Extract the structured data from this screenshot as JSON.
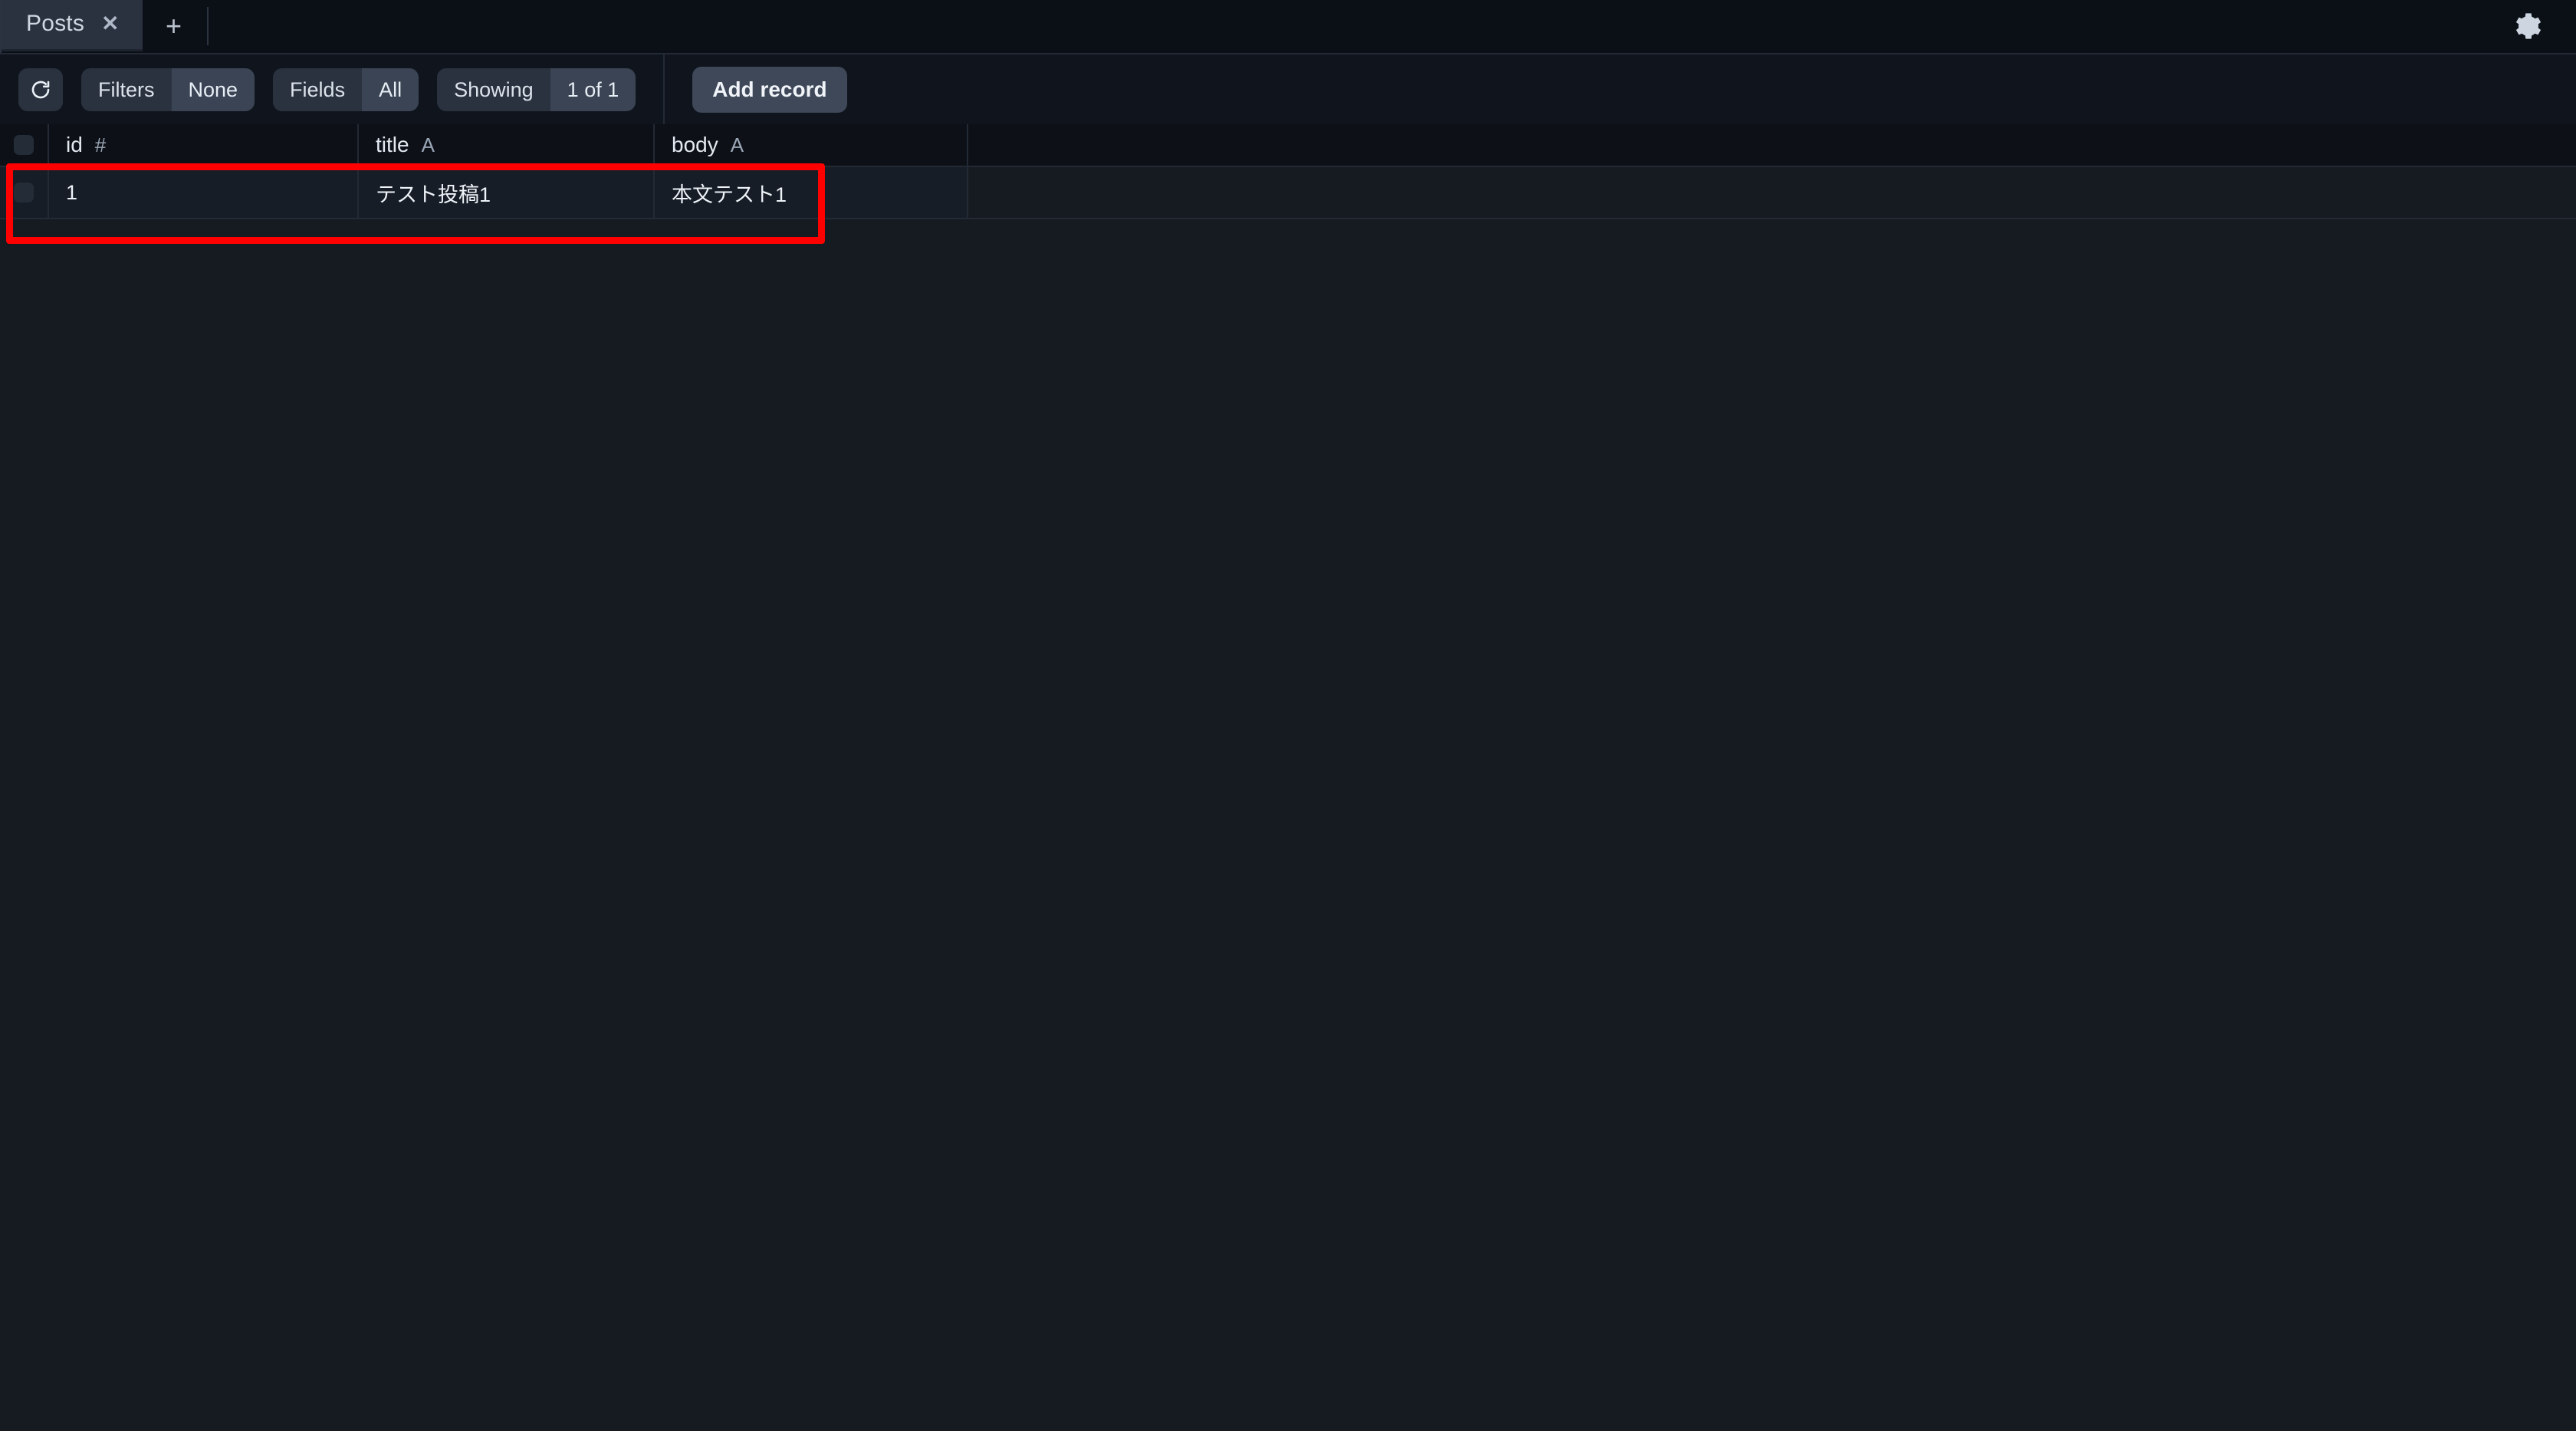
{
  "tabbar": {
    "tabs": [
      {
        "label": "Posts",
        "close_icon": "close-icon",
        "active": true
      }
    ],
    "new_tab_label": "+",
    "close_glyph": "✕",
    "settings_icon": "gear-icon"
  },
  "toolbar": {
    "refresh_icon": "refresh-icon",
    "segments": [
      {
        "key": "Filters",
        "value": "None"
      },
      {
        "key": "Fields",
        "value": "All"
      },
      {
        "key": "Showing",
        "value": "1 of 1"
      }
    ],
    "add_record_label": "Add record"
  },
  "grid": {
    "columns": [
      {
        "name": "id",
        "type_glyph": "#"
      },
      {
        "name": "title",
        "type_glyph": "A"
      },
      {
        "name": "body",
        "type_glyph": "A"
      }
    ],
    "rows": [
      {
        "id": "1",
        "title": "テスト投稿1",
        "body": "本文テスト1"
      }
    ]
  },
  "annotation": {
    "color": "#fe0000",
    "target": "first-data-row"
  },
  "colors": {
    "background": "#161b22",
    "tabbar_bg": "#0b0f16",
    "toolbar_bg": "#10151d",
    "header_bg": "#0d1117",
    "row_bg": "#171d26",
    "accent_button": "#3e4858",
    "annotation_red": "#fe0000"
  }
}
